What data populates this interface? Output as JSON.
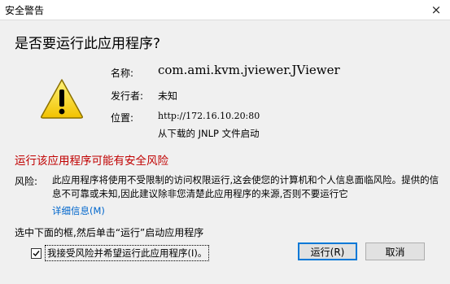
{
  "window": {
    "title": "安全警告",
    "close_icon": "×"
  },
  "dialog": {
    "heading": "是否要运行此应用程序?",
    "name_label": "名称:",
    "name_value": "com.ami.kvm.jviewer.JViewer",
    "publisher_label": "发行者:",
    "publisher_value": "未知",
    "location_label": "位置:",
    "location_value": "http://172.16.10.20:80",
    "location_sub": "从下载的 JNLP 文件启动",
    "risk_title": "运行该应用程序可能有安全风险",
    "risk_label": "风险:",
    "risk_text": "此应用程序将使用不受限制的访问权限运行,这会使您的计算机和个人信息面临风险。提供的信息不可靠或未知,因此建议除非您清楚此应用程序的来源,否则不要运行它",
    "details_link": "详细信息(M)",
    "select_text": "选中下面的框,然后单击“运行”启动应用程序",
    "accept_label": "我接受风险并希望运行此应用程序(I)。",
    "accept_checked": true,
    "run_button": "运行(R)",
    "cancel_button": "取消"
  },
  "colors": {
    "risk_red": "#c00000",
    "link_blue": "#0066cc",
    "focus_blue": "#0078d7",
    "warning_yellow": "#ffd800"
  },
  "icons": {
    "warning": "warning-triangle-icon",
    "close": "close-icon",
    "check": "checkmark-icon"
  }
}
